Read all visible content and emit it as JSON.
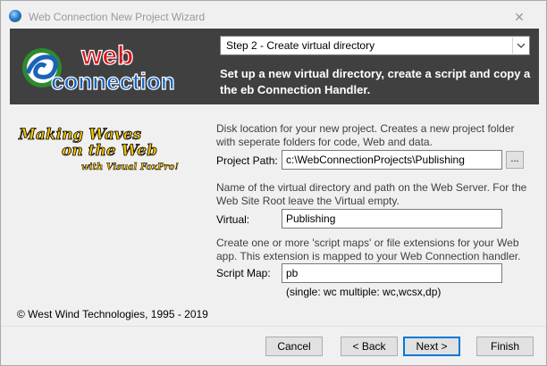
{
  "window": {
    "title": "Web Connection New Project Wizard",
    "close_glyph": "✕"
  },
  "banner": {
    "step_selected": "Step 2 - Create virtual directory",
    "description": "Set up a new virtual directory, create a script and copy a the eb Connection Handler.",
    "logo_line1": "web",
    "logo_line2": "connection",
    "logo_icon": "wave-swirl-icon"
  },
  "left_panel": {
    "art_line1": "Making Waves",
    "art_line2": "on the Web",
    "art_line3": "with Visual FoxPro!",
    "copyright": "© West Wind Technologies, 1995 - 2019"
  },
  "form": {
    "disk_help": "Disk location for your new project. Creates a new project folder with seperate folders for code, Web and data.",
    "project_path_label": "Project Path:",
    "project_path_value": "c:\\WebConnectionProjects\\Publishing",
    "browse_label": "...",
    "virtual_help": "Name of the virtual directory and path on the Web Server. For the Web Site Root leave the Virtual empty.",
    "virtual_label": "Virtual:",
    "virtual_value": "Publishing",
    "script_help": "Create one or more 'script maps' or file extensions for your Web app. This extension is mapped to your Web Connection handler.",
    "script_map_label": "Script Map:",
    "script_map_value": "pb",
    "script_map_hint": "(single: wc  multiple: wc,wcsx,dp)"
  },
  "buttons": {
    "cancel": "Cancel",
    "back": "Back",
    "next": "Next",
    "finish": "Finish"
  },
  "colors": {
    "banner_bg": "#404040",
    "logo_red": "#d8141e",
    "logo_blue": "#1a63b8",
    "logo_green": "#2e8a2e",
    "accent": "#0078d7",
    "art_yellow": "#f5c400"
  }
}
